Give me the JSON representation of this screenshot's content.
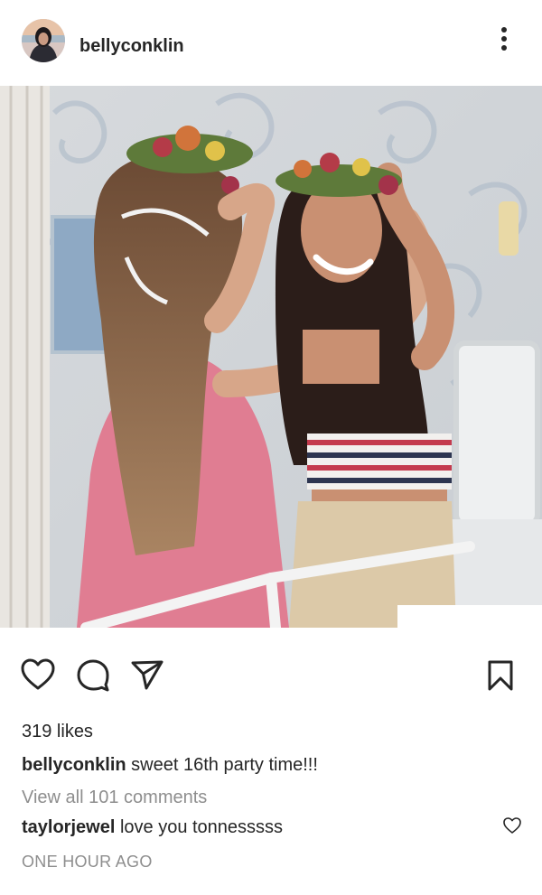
{
  "post": {
    "username": "bellyconklin",
    "likes_text": "319 likes",
    "caption": {
      "username": "bellyconklin",
      "text": "sweet 16th party time!!!"
    },
    "view_all_comments": "View all 101 comments",
    "comment": {
      "username": "taylorjewel",
      "text": "love you tonnesssss"
    },
    "timestamp": "ONE HOUR AGO"
  },
  "icons": {
    "more": "more-options-icon",
    "like": "heart-icon",
    "comment": "comment-icon",
    "share": "send-icon",
    "save": "bookmark-icon",
    "comment_like": "heart-icon"
  },
  "colors": {
    "text": "#262626",
    "secondary_text": "#8e8e8e",
    "background": "#ffffff"
  }
}
